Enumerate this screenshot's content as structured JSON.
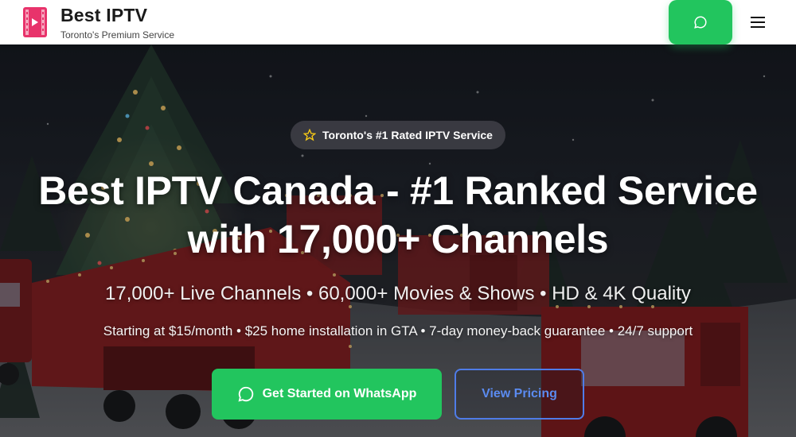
{
  "header": {
    "brand_title": "Best IPTV",
    "brand_subtitle": "Toronto's Premium Service",
    "whatsapp_icon": "whatsapp-chat-icon",
    "menu_icon": "hamburger-menu-icon"
  },
  "hero": {
    "badge_text": "Toronto's #1 Rated IPTV Service",
    "title_line1": "Best IPTV Canada - #1 Ranked Service",
    "title_line2": "with 17,000+ Channels",
    "subtitle": "17,000+ Live Channels • 60,000+ Movies & Shows • HD & 4K Quality",
    "note": "Starting at $15/month • $25 home installation in GTA • 7-day money-back guarantee • 24/7 support",
    "primary_cta": "Get Started on WhatsApp",
    "secondary_cta": "View Pricing"
  },
  "colors": {
    "accent_green": "#22c55e",
    "accent_blue": "#4f7ce8",
    "logo_pink": "#e8336b"
  }
}
